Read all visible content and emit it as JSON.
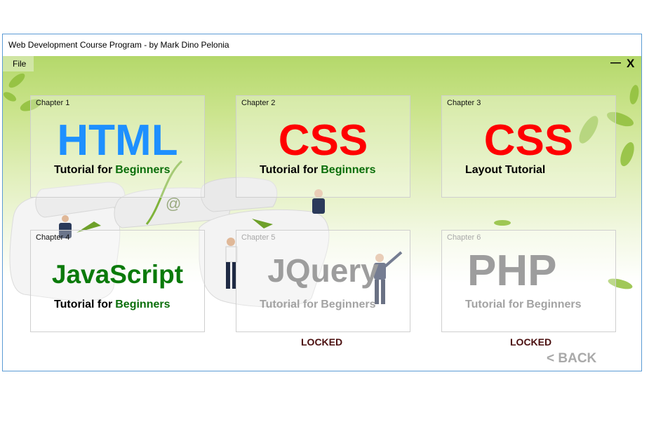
{
  "window": {
    "title": "Web Development Course Program - by Mark Dino Pelonia",
    "minimize_label": "—",
    "close_label": "X"
  },
  "menu": {
    "file_label": "File"
  },
  "chapters": [
    {
      "chapter_label": "Chapter 1",
      "title": "HTML",
      "sub_left": "Tutorial for",
      "sub_right": "Beginners",
      "title_color": "#1e90ff",
      "locked": false
    },
    {
      "chapter_label": "Chapter 2",
      "title": "CSS",
      "sub_left": "Tutorial for",
      "sub_right": "Beginners",
      "title_color": "#ff0000",
      "locked": false
    },
    {
      "chapter_label": "Chapter 3",
      "title": "CSS",
      "sub_left": "Layout Tutorial",
      "sub_right": "",
      "title_color": "#ff0000",
      "locked": false
    },
    {
      "chapter_label": "Chapter 4",
      "title": "JavaScript",
      "sub_left": "Tutorial for",
      "sub_right": "Beginners",
      "title_color": "#0a7a0a",
      "locked": false
    },
    {
      "chapter_label": "Chapter 5",
      "title": "JQuery",
      "sub_left": "Tutorial for",
      "sub_right": "Beginners",
      "title_color": "#9d9d9d",
      "locked": true,
      "status": "LOCKED"
    },
    {
      "chapter_label": "Chapter 6",
      "title": "PHP",
      "sub_left": "Tutorial for",
      "sub_right": "Beginners",
      "title_color": "#9d9d9d",
      "locked": true,
      "status": "LOCKED"
    }
  ],
  "back_label": "< BACK"
}
